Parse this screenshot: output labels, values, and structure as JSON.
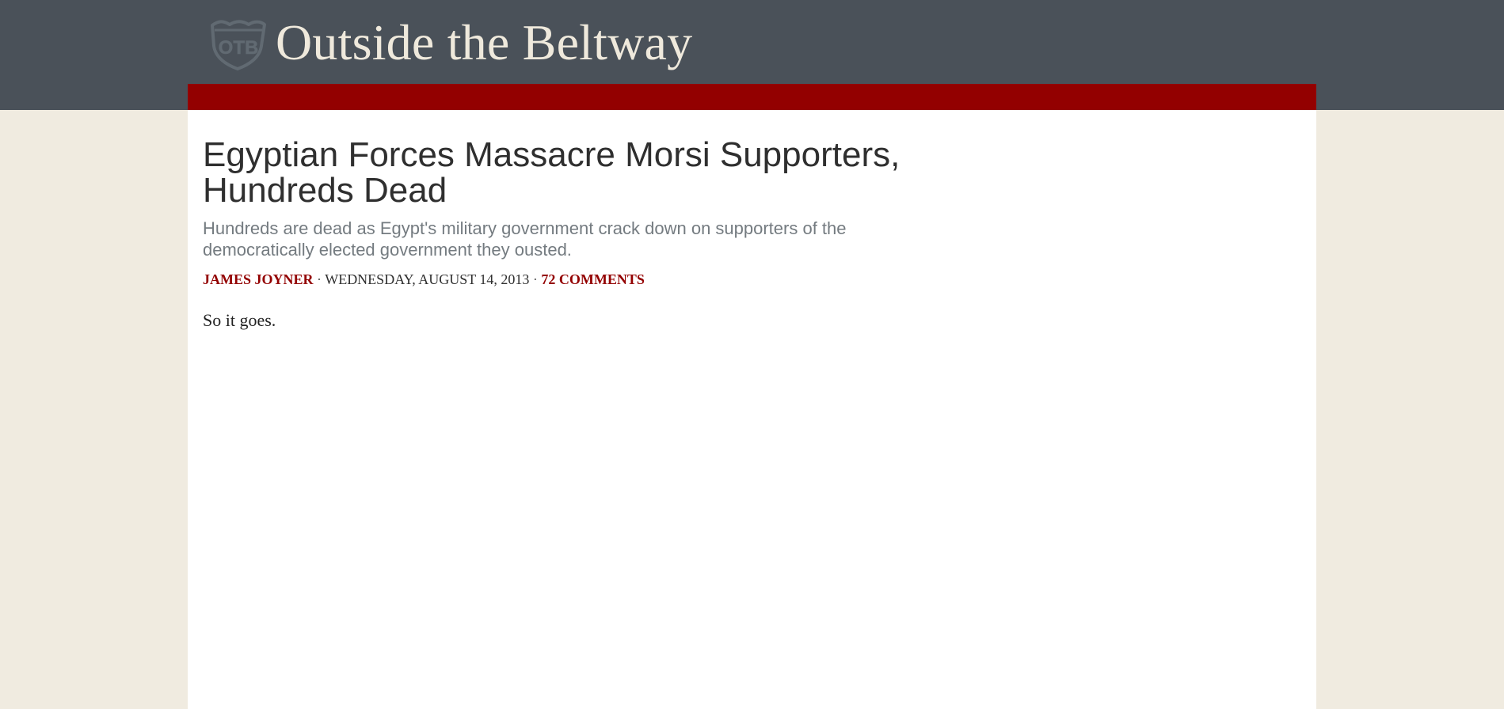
{
  "site": {
    "logo_text": "OTB",
    "title": "Outside the Beltway"
  },
  "colors": {
    "header_bg": "#4a5159",
    "accent": "#930000",
    "page_bg": "#f0ebe0",
    "content_bg": "#ffffff"
  },
  "article": {
    "headline": "Egyptian Forces Massacre Morsi Supporters, Hundreds Dead",
    "dek": "Hundreds are dead as Egypt's military government crack down on supporters of the democratically elected government they ousted.",
    "author": "JAMES JOYNER",
    "separator": "·",
    "date": "WEDNESDAY, AUGUST 14, 2013",
    "comments": "72 COMMENTS",
    "body": "So it goes."
  }
}
